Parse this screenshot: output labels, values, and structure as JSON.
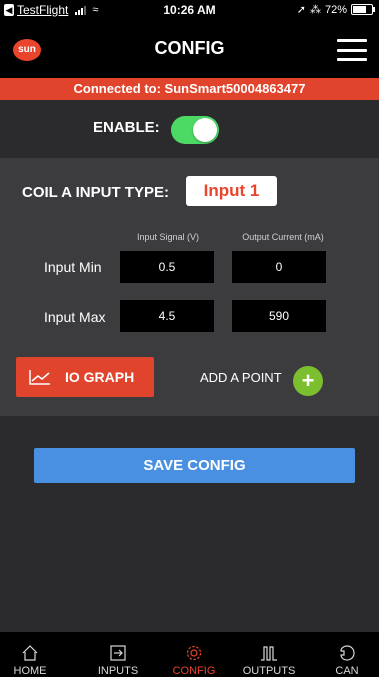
{
  "status_bar": {
    "app": "TestFlight",
    "time": "10:26 AM",
    "battery": "72%"
  },
  "header": {
    "logo_text": "sun",
    "title": "CONFIG"
  },
  "banner": {
    "text": "Connected to: SunSmart50004863477"
  },
  "enable": {
    "label": "ENABLE:",
    "state": "on"
  },
  "coil": {
    "label": "COIL A INPUT TYPE:",
    "input_type": "Input 1",
    "col_input_signal": "Input Signal (V)",
    "col_output_current": "Output Current (mA)",
    "rows": [
      {
        "label": "Input Min",
        "signal": "0.5",
        "current": "0"
      },
      {
        "label": "Input Max",
        "signal": "4.5",
        "current": "590"
      }
    ]
  },
  "actions": {
    "io_graph": "IO GRAPH",
    "add_point": "ADD A POINT",
    "save": "SAVE CONFIG"
  },
  "nav": {
    "items": [
      {
        "label": "HOME",
        "icon": "home-icon"
      },
      {
        "label": "INPUTS",
        "icon": "inputs-icon"
      },
      {
        "label": "CONFIG",
        "icon": "gear-icon",
        "active": true
      },
      {
        "label": "OUTPUTS",
        "icon": "outputs-icon"
      },
      {
        "label": "CAN",
        "icon": "can-icon"
      }
    ]
  },
  "colors": {
    "accent": "#e0442c",
    "toggle_on": "#4cd964",
    "save_button": "#4a90e2",
    "add_button": "#7cbf2e"
  }
}
